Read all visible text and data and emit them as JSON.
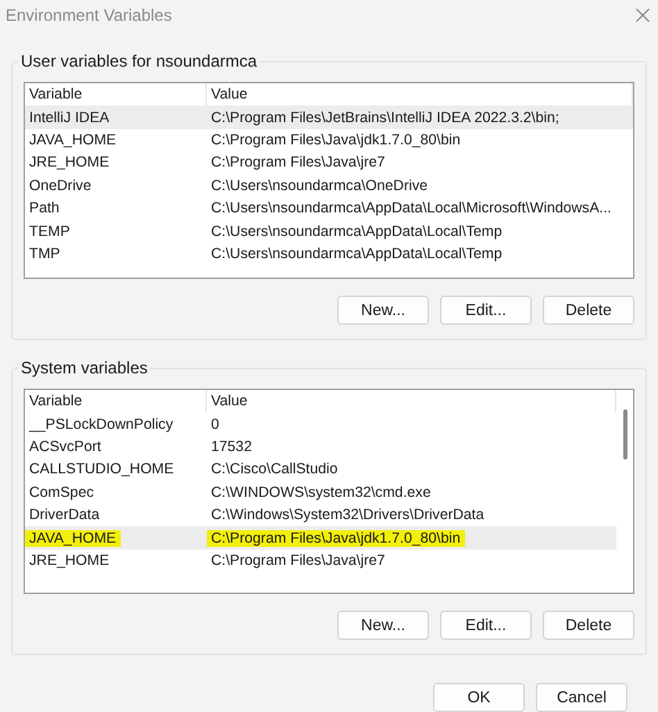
{
  "window": {
    "title": "Environment Variables"
  },
  "user_variables": {
    "label": "User variables for nsoundarmca",
    "columns": [
      "Variable",
      "Value"
    ],
    "rows": [
      {
        "variable": "IntelliJ IDEA",
        "value": "C:\\Program Files\\JetBrains\\IntelliJ IDEA 2022.3.2\\bin;",
        "selected": true,
        "highlighted": false
      },
      {
        "variable": "JAVA_HOME",
        "value": "C:\\Program Files\\Java\\jdk1.7.0_80\\bin",
        "selected": false,
        "highlighted": false
      },
      {
        "variable": "JRE_HOME",
        "value": "C:\\Program Files\\Java\\jre7",
        "selected": false,
        "highlighted": false
      },
      {
        "variable": "OneDrive",
        "value": "C:\\Users\\nsoundarmca\\OneDrive",
        "selected": false,
        "highlighted": false
      },
      {
        "variable": "Path",
        "value": "C:\\Users\\nsoundarmca\\AppData\\Local\\Microsoft\\WindowsA...",
        "selected": false,
        "highlighted": false
      },
      {
        "variable": "TEMP",
        "value": "C:\\Users\\nsoundarmca\\AppData\\Local\\Temp",
        "selected": false,
        "highlighted": false
      },
      {
        "variable": "TMP",
        "value": "C:\\Users\\nsoundarmca\\AppData\\Local\\Temp",
        "selected": false,
        "highlighted": false
      }
    ],
    "buttons": [
      "New...",
      "Edit...",
      "Delete"
    ]
  },
  "system_variables": {
    "label": "System variables",
    "columns": [
      "Variable",
      "Value"
    ],
    "rows": [
      {
        "variable": "__PSLockDownPolicy",
        "value": "0",
        "selected": false,
        "highlighted": false
      },
      {
        "variable": "ACSvcPort",
        "value": "17532",
        "selected": false,
        "highlighted": false
      },
      {
        "variable": "CALLSTUDIO_HOME",
        "value": "C:\\Cisco\\CallStudio",
        "selected": false,
        "highlighted": false
      },
      {
        "variable": "ComSpec",
        "value": "C:\\WINDOWS\\system32\\cmd.exe",
        "selected": false,
        "highlighted": false
      },
      {
        "variable": "DriverData",
        "value": "C:\\Windows\\System32\\Drivers\\DriverData",
        "selected": false,
        "highlighted": false
      },
      {
        "variable": "JAVA_HOME",
        "value": "C:\\Program Files\\Java\\jdk1.7.0_80\\bin",
        "selected": true,
        "highlighted": true
      },
      {
        "variable": "JRE_HOME",
        "value": "C:\\Program Files\\Java\\jre7",
        "selected": false,
        "highlighted": false
      }
    ],
    "buttons": [
      "New...",
      "Edit...",
      "Delete"
    ]
  },
  "buttons": [
    "OK",
    "Cancel"
  ]
}
